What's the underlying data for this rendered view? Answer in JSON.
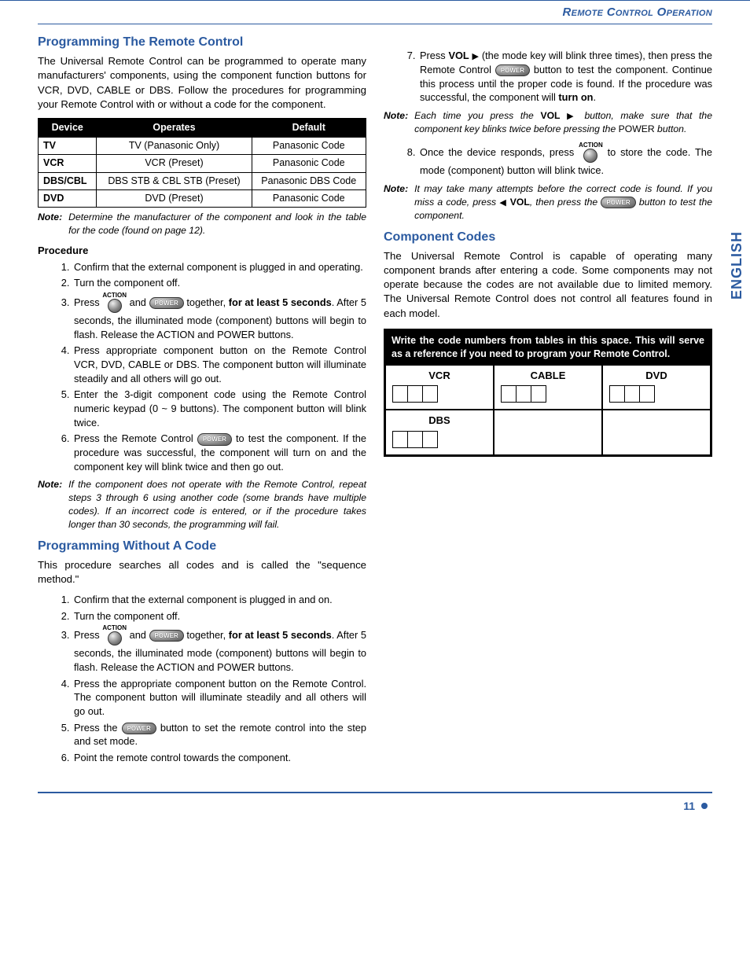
{
  "header": {
    "section_title": "Remote Control Operation"
  },
  "side_tab": "ENGLISH",
  "footer": {
    "page": "11"
  },
  "icons": {
    "power_label": "POWER",
    "action_label": "ACTION"
  },
  "left": {
    "h_prog": "Programming The Remote Control",
    "intro": "The Universal Remote Control can be programmed to operate many manufacturers' components, using the component function buttons for VCR, DVD, CABLE or DBS. Follow the procedures for programming your Remote Control with or without a code for the component.",
    "table": {
      "headers": [
        "Device",
        "Operates",
        "Default"
      ],
      "rows": [
        [
          "TV",
          "TV (Panasonic Only)",
          "Panasonic Code"
        ],
        [
          "VCR",
          "VCR (Preset)",
          "Panasonic Code"
        ],
        [
          "DBS/CBL",
          "DBS STB & CBL STB (Preset)",
          "Panasonic DBS Code"
        ],
        [
          "DVD",
          "DVD (Preset)",
          "Panasonic Code"
        ]
      ]
    },
    "note1_label": "Note:",
    "note1_text": "Determine the manufacturer of the component and look in the table for the code (found on page 12).",
    "procedure_label": "Procedure",
    "proc1": {
      "s1": "Confirm that the external component is plugged in and operating.",
      "s2": "Turn the component off.",
      "s3_a": "Press ",
      "s3_b": " and ",
      "s3_c": " together, ",
      "s3_bold": "for at least 5 seconds",
      "s3_d": ". After 5 seconds, the illuminated mode (component) buttons will begin to flash. Release the ACTION and POWER buttons.",
      "s4": "Press appropriate component button on the Remote Control VCR, DVD, CABLE or DBS. The component button will illuminate steadily and all others will go out.",
      "s5": "Enter the 3-digit component code using the Remote Control numeric keypad (0 ~ 9 buttons). The component button will blink twice.",
      "s6_a": "Press the Remote Control ",
      "s6_b": " to test the component. If the procedure was successful, the component will turn on and the component key will blink twice and then go out."
    },
    "note2_label": "Note:",
    "note2_text": "If the component does not operate with the Remote Control, repeat steps 3 through 6 using another code (some brands have multiple codes). If an incorrect code is entered, or if the procedure takes longer than 30 seconds, the programming will fail.",
    "h_nocode": "Programming Without A Code",
    "nocode_intro": "This procedure searches all codes and is called the \"sequence method.\"",
    "proc2": {
      "s1": "Confirm that the external component is plugged in and on.",
      "s2": "Turn the component off.",
      "s3_a": "Press ",
      "s3_b": " and ",
      "s3_c": " together, ",
      "s3_bold": "for at least 5 seconds",
      "s3_d": ". After 5 seconds, the illuminated mode (component) buttons will begin to flash. Release the ACTION and POWER buttons.",
      "s4": "Press the appropriate component button on the Remote Control. The component button will illuminate steadily and all others will go out.",
      "s5_a": "Press the ",
      "s5_b": " button to set the remote control into the step and set mode.",
      "s6": "Point the remote control towards the component."
    }
  },
  "right": {
    "s7_a": "Press ",
    "s7_vol": "VOL",
    "s7_b": " (the mode key will blink three times), then press the Remote Control ",
    "s7_c": " button to test the component. Continue this process until the proper code is found. If the procedure was successful, the component will ",
    "s7_turn_on": "turn on",
    "s7_d": ".",
    "note3_label": "Note:",
    "note3_a": "Each time you press the ",
    "note3_vol": "VOL",
    "note3_b": " button, make sure that the component key blinks twice before pressing the ",
    "note3_pow": "POWER",
    "note3_c": " button.",
    "s8_a": "Once the device responds, press ",
    "s8_b": " to store the code. The mode (component) button will blink twice.",
    "note4_label": "Note:",
    "note4_a": "It may take many attempts before the correct code is found. If you miss a code, press ",
    "note4_vol": "VOL",
    "note4_b": ", then press the ",
    "note4_c": " button to test the component.",
    "h_codes": "Component Codes",
    "codes_intro": "The Universal Remote Control is capable of operating many component brands after entering a code. Some components may not operate because the codes are not available due to limited memory. The Universal Remote Control does not control all features found in each model.",
    "box_header": "Write the code numbers from tables in this space. This will serve as a reference if you need to program your Remote Control.",
    "cells": [
      "VCR",
      "CABLE",
      "DVD",
      "DBS",
      "",
      ""
    ]
  }
}
